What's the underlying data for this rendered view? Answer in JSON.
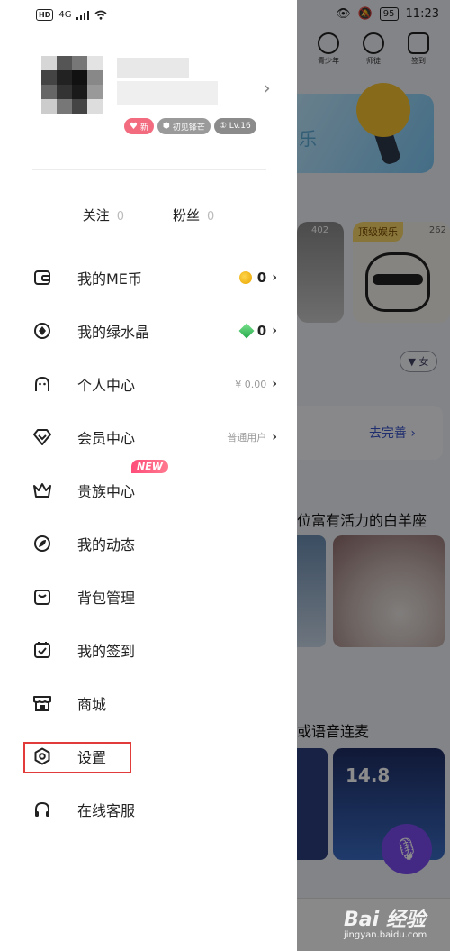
{
  "status_bar": {
    "left_hd": "HD",
    "left_net": "4G",
    "right_battery": "95",
    "right_time": "11:23"
  },
  "background": {
    "top_icons": [
      "青少年",
      "师徒",
      "签到"
    ],
    "banner_text": "乐",
    "card_counts": [
      "402",
      "262"
    ],
    "card_tag": "顶级娱乐",
    "filter_label": "▼ 女",
    "complete_label": "去完善 ›",
    "section1": "位富有活力的白羊座",
    "section2": "或语音连麦",
    "game_score": "14.8"
  },
  "profile": {
    "badges": {
      "new_label": "新",
      "level_label": "初见锋芒",
      "lv_label": "① Lv.16"
    },
    "arrow": "›"
  },
  "follow": {
    "following_label": "关注",
    "following_count": "0",
    "fans_label": "粉丝",
    "fans_count": "0"
  },
  "menu": [
    {
      "label": "我的ME币",
      "value": "0",
      "icon": "wallet-icon"
    },
    {
      "label": "我的绿水晶",
      "value": "0",
      "icon": "crystal-icon"
    },
    {
      "label": "个人中心",
      "value": "¥ 0.00",
      "icon": "person-icon"
    },
    {
      "label": "会员中心",
      "value": "普通用户",
      "icon": "vip-diamond-icon"
    },
    {
      "label": "贵族中心",
      "badge": "NEW",
      "icon": "crown-icon"
    },
    {
      "label": "我的动态",
      "icon": "leaf-icon"
    },
    {
      "label": "背包管理",
      "icon": "backpack-icon"
    },
    {
      "label": "我的签到",
      "icon": "calendar-check-icon"
    },
    {
      "label": "商城",
      "icon": "store-icon"
    },
    {
      "label": "设置",
      "icon": "settings-hexagon-icon"
    },
    {
      "label": "在线客服",
      "icon": "headset-icon"
    }
  ],
  "chevron": "›",
  "watermark": {
    "main": "Bai 经验",
    "sub": "jingyan.baidu.com"
  },
  "colors": {
    "highlight": "#e23b3b",
    "new_badge": "#ff4d7a",
    "accent_purple": "#7b4cf0"
  }
}
